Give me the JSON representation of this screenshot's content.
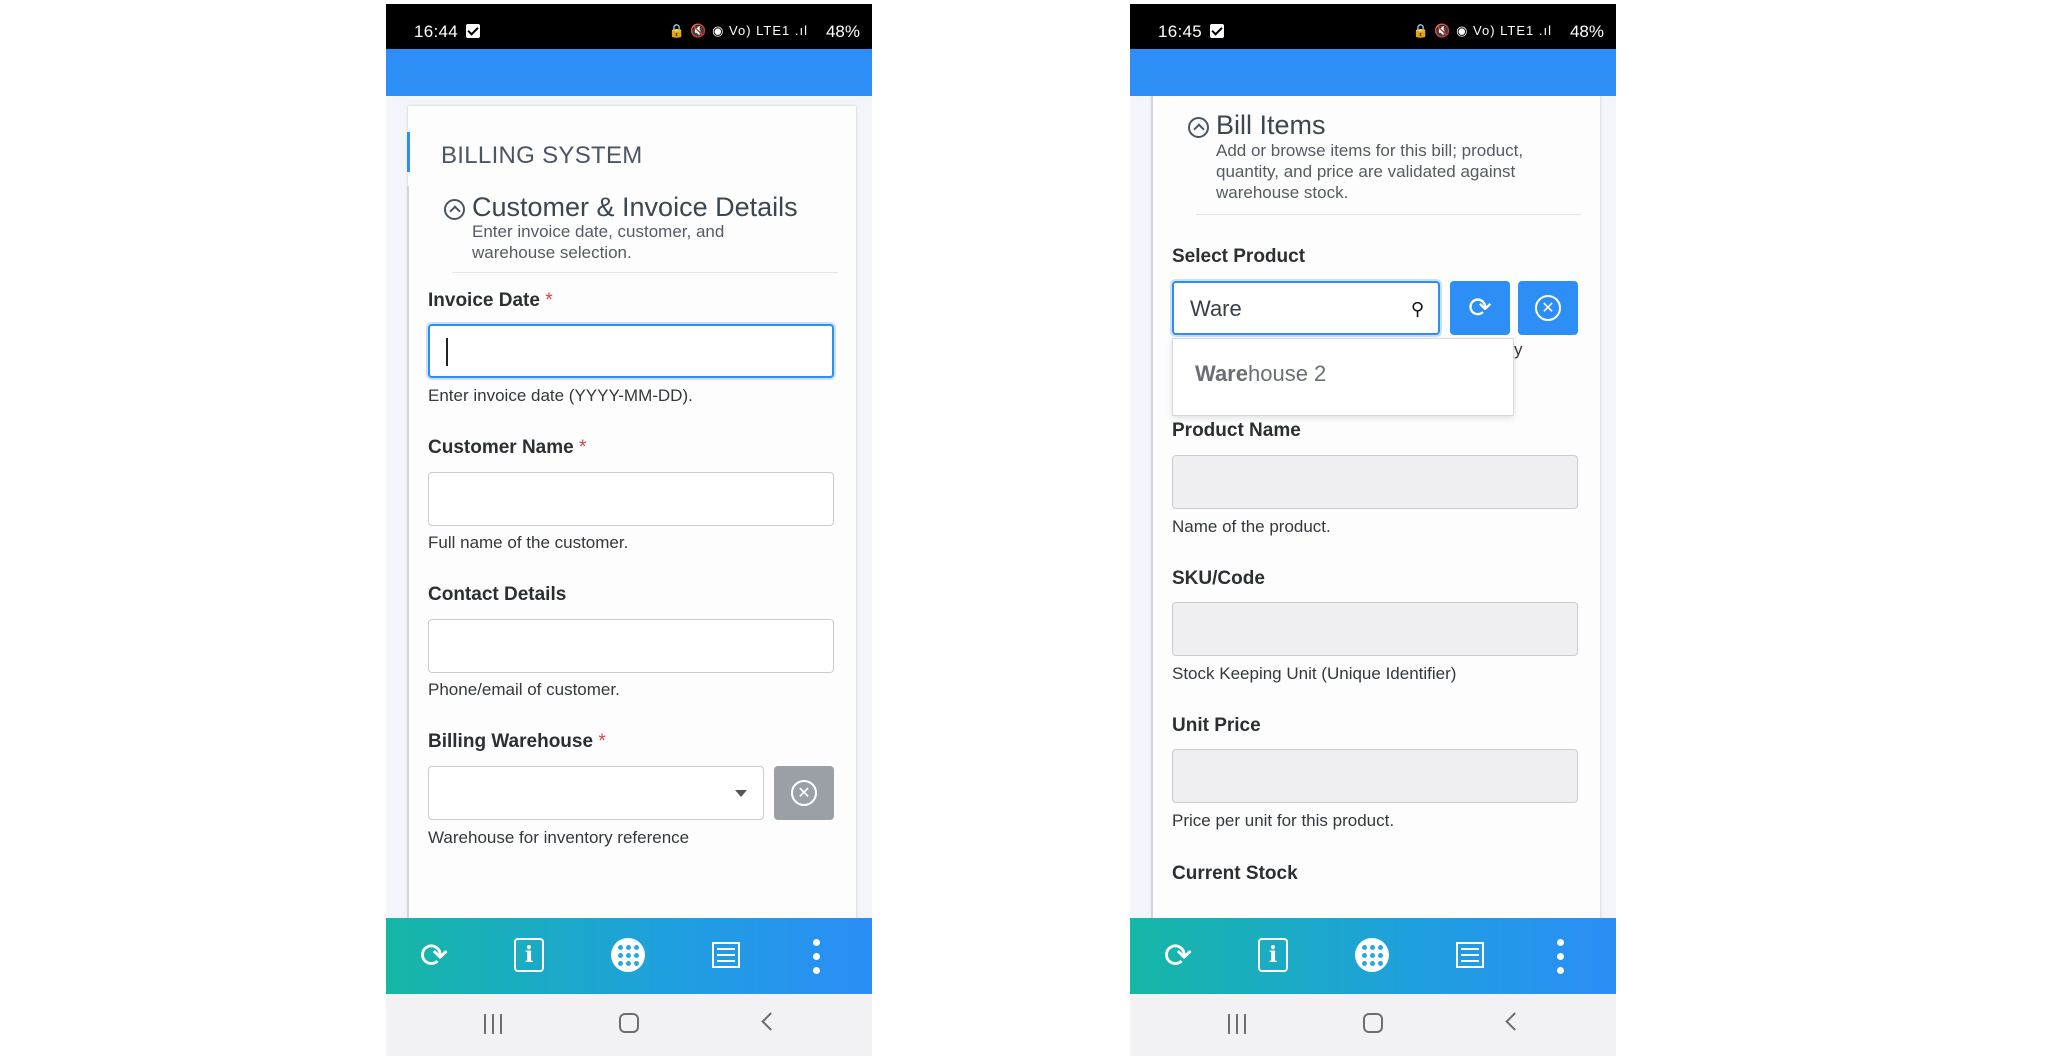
{
  "colors": {
    "accent": "#2d8ef5",
    "required": "#d64545",
    "nav_gradient_start": "#16b7a6",
    "nav_gradient_end": "#2b8df6"
  },
  "left": {
    "status": {
      "time": "16:44",
      "icons": "🔒 🔇 ◉ Vo) LTE1 .ıl",
      "battery": "48%"
    },
    "card_title": "BILLING SYSTEM",
    "section": {
      "title": "Customer & Invoice Details",
      "description_line1": "Enter invoice date, customer, and",
      "description_line2": "warehouse selection."
    },
    "fields": {
      "invoice_date": {
        "label": "Invoice Date",
        "required": "*",
        "value": "",
        "help": "Enter invoice date (YYYY-MM-DD)."
      },
      "customer_name": {
        "label": "Customer Name",
        "required": "*",
        "value": "",
        "help": "Full name of the customer."
      },
      "contact_details": {
        "label": "Contact Details",
        "value": "",
        "help": "Phone/email of customer."
      },
      "billing_warehouse": {
        "label": "Billing Warehouse",
        "required": "*",
        "value": "",
        "help": "Warehouse for inventory reference"
      }
    }
  },
  "right": {
    "status": {
      "time": "16:45",
      "icons": "🔒 🔇 ◉ Vo) LTE1 .ıl",
      "battery": "48%"
    },
    "section": {
      "title": "Bill Items",
      "description_line1": "Add or browse items for this bill; product,",
      "description_line2": "quantity, and price are validated against",
      "description_line3": "warehouse stock."
    },
    "select_product": {
      "label": "Select Product",
      "search_value": "Ware",
      "peek_text": "y",
      "dropdown_match": "Ware",
      "dropdown_rest": "house 2"
    },
    "fields": {
      "product_name": {
        "label": "Product Name",
        "value": "",
        "help": "Name of the product."
      },
      "sku": {
        "label": "SKU/Code",
        "value": "",
        "help": "Stock Keeping Unit (Unique Identifier)"
      },
      "unit_price": {
        "label": "Unit Price",
        "value": "",
        "help": "Price per unit for this product."
      },
      "current_stock": {
        "label": "Current Stock"
      }
    }
  },
  "bottom_nav": [
    "refresh-icon",
    "info-icon",
    "grid-icon",
    "list-icon",
    "more-icon"
  ],
  "system_nav": [
    "recent-apps-icon",
    "home-icon",
    "back-icon"
  ]
}
